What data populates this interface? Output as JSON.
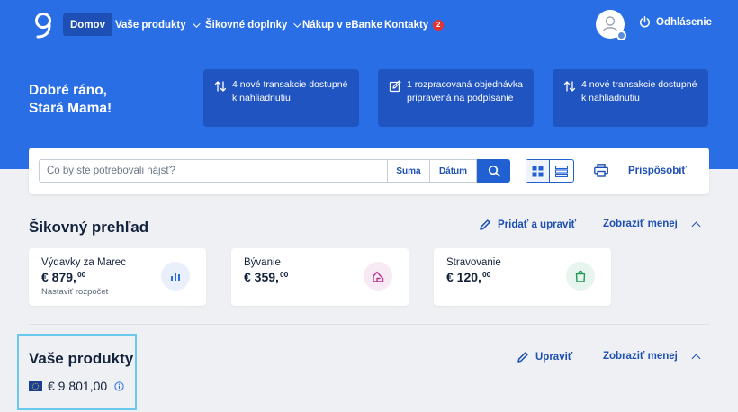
{
  "colors": {
    "primary": "#2a6ee6",
    "dark_blue": "#1d4fb4",
    "badge_red": "#e5322d",
    "highlight": "#6ac8ee"
  },
  "nav": {
    "items": [
      {
        "label": "Domov",
        "active": true
      },
      {
        "label": "Vaše produkty",
        "dropdown": true
      },
      {
        "label": "Šikovné doplnky",
        "dropdown": true
      },
      {
        "label": "Nákup v eBanke"
      },
      {
        "label": "Kontakty",
        "badge": "2"
      }
    ],
    "logout_label": "Odhlásenie"
  },
  "greeting": {
    "line1": "Dobré ráno,",
    "line2": "Stará Mama!"
  },
  "notifications": [
    {
      "icon": "transfer-arrows-icon",
      "text": "4 nové transakcie dostupné k nahliadnutiu"
    },
    {
      "icon": "edit-document-icon",
      "text": "1 rozpracovaná objednávka pripravená na podpísanie"
    },
    {
      "icon": "transfer-arrows-icon",
      "text": "4 nové transakcie dostupné k nahliadnutiu"
    }
  ],
  "search": {
    "placeholder": "Čo by ste potrebovali nájsť?",
    "amount_label": "Suma",
    "date_label": "Dátum",
    "customize_label": "Prispôsobiť"
  },
  "overview": {
    "title": "Šikovný prehľad",
    "add_edit_label": "Pridať a upraviť",
    "show_less_label": "Zobraziť menej",
    "cards": [
      {
        "label": "Výdavky za Marec",
        "amount": "€ 879,",
        "cents": "00",
        "sub": "Nastaviť rozpočet",
        "icon": "bar-chart-icon"
      },
      {
        "label": "Bývanie",
        "amount": "€ 359,",
        "cents": "00",
        "icon": "house-icon"
      },
      {
        "label": "Stravovanie",
        "amount": "€ 120,",
        "cents": "00",
        "icon": "shopping-bag-icon"
      }
    ]
  },
  "products": {
    "title": "Vaše produkty",
    "edit_label": "Upraviť",
    "show_less_label": "Zobraziť menej",
    "total": "€ 9 801,00"
  }
}
